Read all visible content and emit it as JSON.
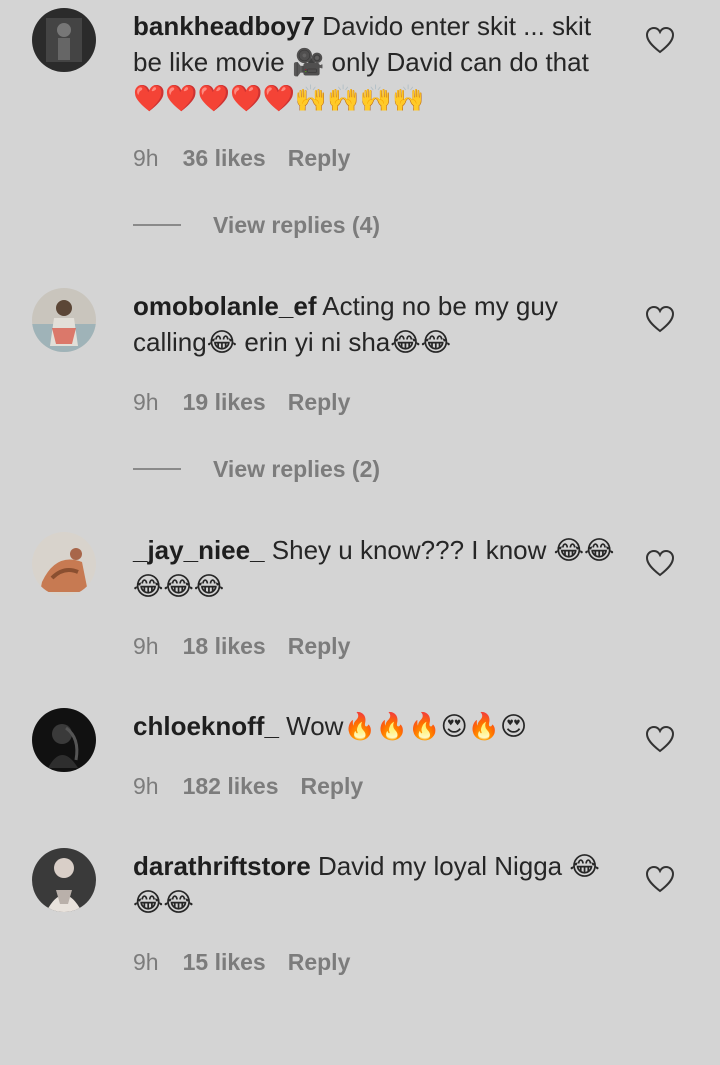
{
  "comments": [
    {
      "username": "bankheadboy7",
      "text": "Davido enter skit ... skit be like movie 🎥 only David can do that ❤️❤️❤️❤️❤️🙌🙌🙌🙌",
      "time": "9h",
      "likes": "36 likes",
      "reply": "Reply",
      "view_replies": "View replies (4)"
    },
    {
      "username": "omobolanle_ef",
      "text": "Acting no be my guy calling😂 erin yi ni sha😂😂",
      "time": "9h",
      "likes": "19 likes",
      "reply": "Reply",
      "view_replies": "View replies (2)"
    },
    {
      "username": "_jay_niee_",
      "text": "Shey u know??? I know 😂😂😂😂😂",
      "time": "9h",
      "likes": "18 likes",
      "reply": "Reply"
    },
    {
      "username": "chloeknoff_",
      "text": "Wow🔥🔥🔥😍🔥😍",
      "time": "9h",
      "likes": "182 likes",
      "reply": "Reply"
    },
    {
      "username": "darathriftstore",
      "text": "David my loyal Nigga 😂😂😂",
      "time": "9h",
      "likes": "15 likes",
      "reply": "Reply"
    }
  ],
  "colors": {
    "background": "#d4d4d4",
    "meta_text": "#7c7c7c",
    "username": "#1e1e1e"
  }
}
